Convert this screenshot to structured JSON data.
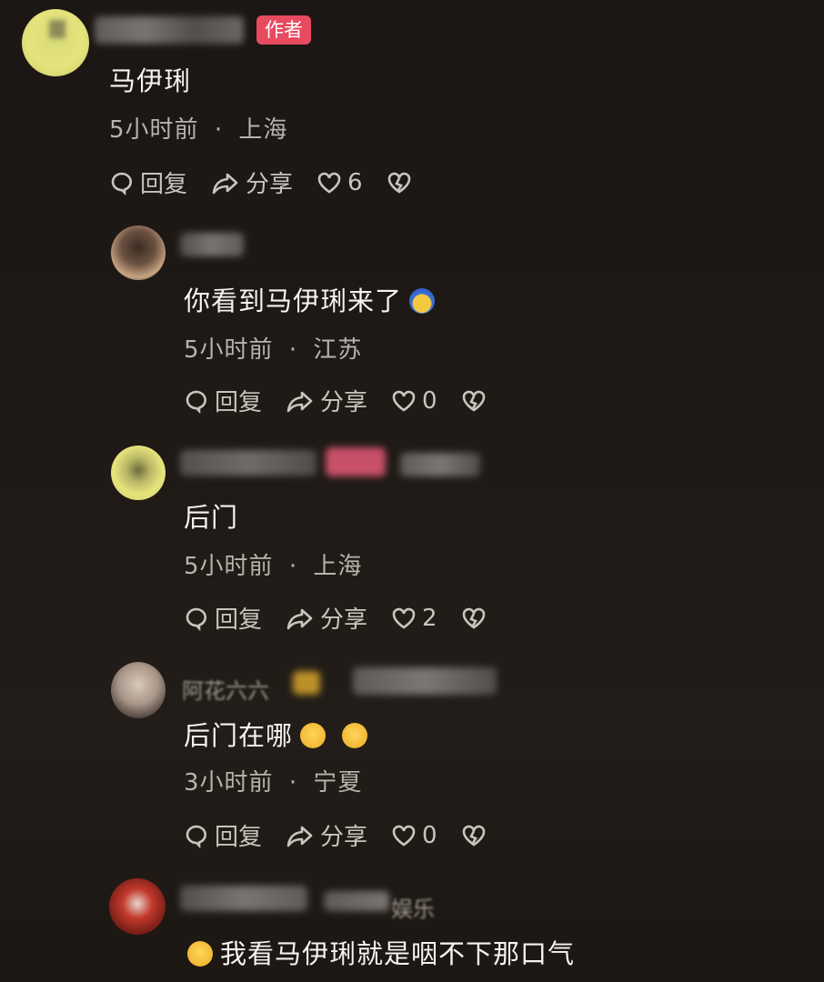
{
  "comments": [
    {
      "author_badge": "作者",
      "text": "马伊琍",
      "time": "5小时前",
      "location": "上海",
      "reply_label": "回复",
      "share_label": "分享",
      "likes": "6"
    },
    {
      "text": "你看到马伊琍来了",
      "time": "5小时前",
      "location": "江苏",
      "reply_label": "回复",
      "share_label": "分享",
      "likes": "0"
    },
    {
      "text": "后门",
      "time": "5小时前",
      "location": "上海",
      "reply_label": "回复",
      "share_label": "分享",
      "likes": "2"
    },
    {
      "partial_name": "阿花六六",
      "text": "后门在哪",
      "time": "3小时前",
      "location": "宁夏",
      "reply_label": "回复",
      "share_label": "分享",
      "likes": "0"
    },
    {
      "partial_name": "娱乐",
      "text": "我看马伊琍就是咽不下那口气"
    }
  ],
  "separator": "·",
  "icons": [
    "comment-bubble-icon",
    "share-arrow-icon",
    "heart-icon",
    "broken-heart-icon",
    "emoji-icon"
  ],
  "colors": {
    "badge": "#e84a5f",
    "text": "#f4f4f4",
    "meta": "#b8b3ad"
  }
}
